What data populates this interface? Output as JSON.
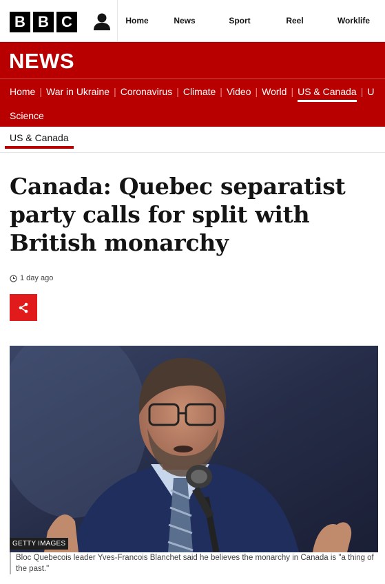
{
  "header": {
    "logo_letters": [
      "B",
      "B",
      "C"
    ],
    "nav": [
      "Home",
      "News",
      "Sport",
      "Reel",
      "Worklife"
    ]
  },
  "brand": {
    "section_title": "NEWS",
    "colors": {
      "news_red": "#b80000",
      "share_red": "#e11b1b"
    }
  },
  "section_nav": {
    "items": [
      "Home",
      "War in Ukraine",
      "Coronavirus",
      "Climate",
      "Video",
      "World",
      "US & Canada",
      "U"
    ],
    "active": "US & Canada",
    "row2": "Science"
  },
  "subnav": {
    "label": "US & Canada"
  },
  "article": {
    "headline": "Canada: Quebec separatist party calls for split with British monarchy",
    "timestamp": "1 day ago",
    "image_credit": "GETTY IMAGES",
    "caption": "Bloc Quebecois leader Yves-Francois Blanchet said he believes the monarchy in Canada is \"a thing of the past.\""
  },
  "icons": [
    "account-icon",
    "clock-icon",
    "share-icon"
  ]
}
